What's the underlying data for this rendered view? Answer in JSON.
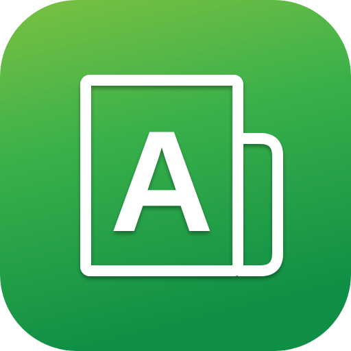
{
  "icon": {
    "name": "app-icon",
    "glyph_icon": "letter-card-icon",
    "letter": "A",
    "colors": {
      "gradient_top": "#7cc142",
      "gradient_mid": "#39b04a",
      "gradient_bottom": "#0f8f45",
      "glyph": "#ffffff"
    }
  }
}
